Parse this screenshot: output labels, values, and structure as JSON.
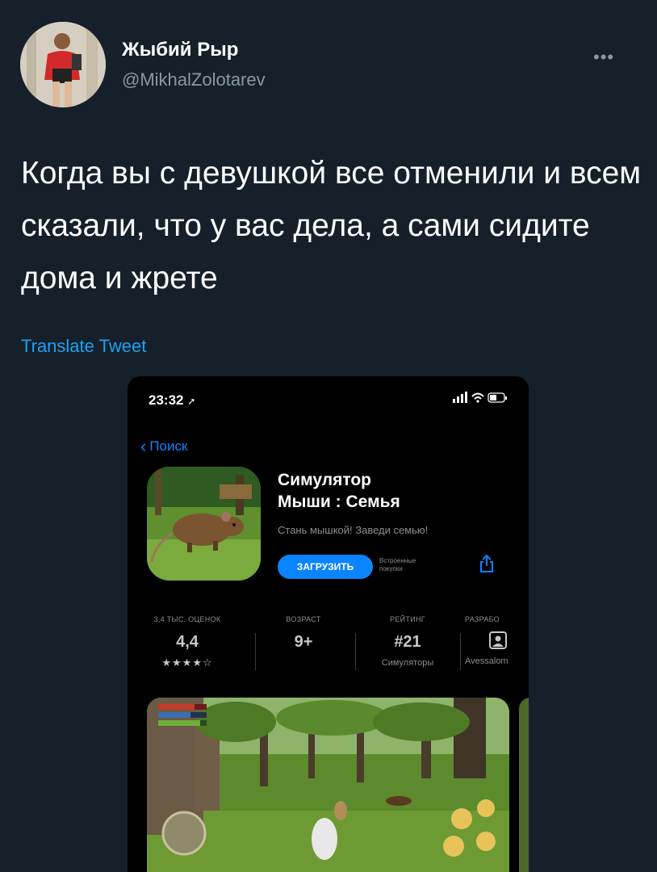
{
  "tweet": {
    "display_name": "Жыбий Рыр",
    "handle": "@MikhalZolotarev",
    "more_icon": "more-dots-icon",
    "text": "Когда вы с девушкой все отменили и всем сказали, что у вас дела, а сами сидите дома и жрете",
    "translate_label": "Translate Tweet"
  },
  "colors": {
    "background": "#15202b",
    "secondary_text": "#8899a6",
    "link": "#1da1f2",
    "ios_accent": "#0a84ff"
  },
  "phone": {
    "time": "23:32",
    "back_label": "Поиск",
    "app": {
      "title_line1": "Симулятор",
      "title_line2": "Мыши : Семья",
      "subtitle": "Стань мышкой! Заведи семью!",
      "get_label": "ЗАГРУЗИТЬ",
      "iap_line1": "Встроенные",
      "iap_line2": "покупки"
    },
    "stats": [
      {
        "label": "3,4 ТЫС. ОЦЕНОК",
        "value": "4,4",
        "rating": 4.5
      },
      {
        "label": "ВОЗРАСТ",
        "value": "9+"
      },
      {
        "label": "РЕЙТИНГ",
        "value": "#21",
        "sub": "Симуляторы"
      },
      {
        "label": "РАЗРАБО",
        "sub": "Avessalom"
      }
    ]
  }
}
